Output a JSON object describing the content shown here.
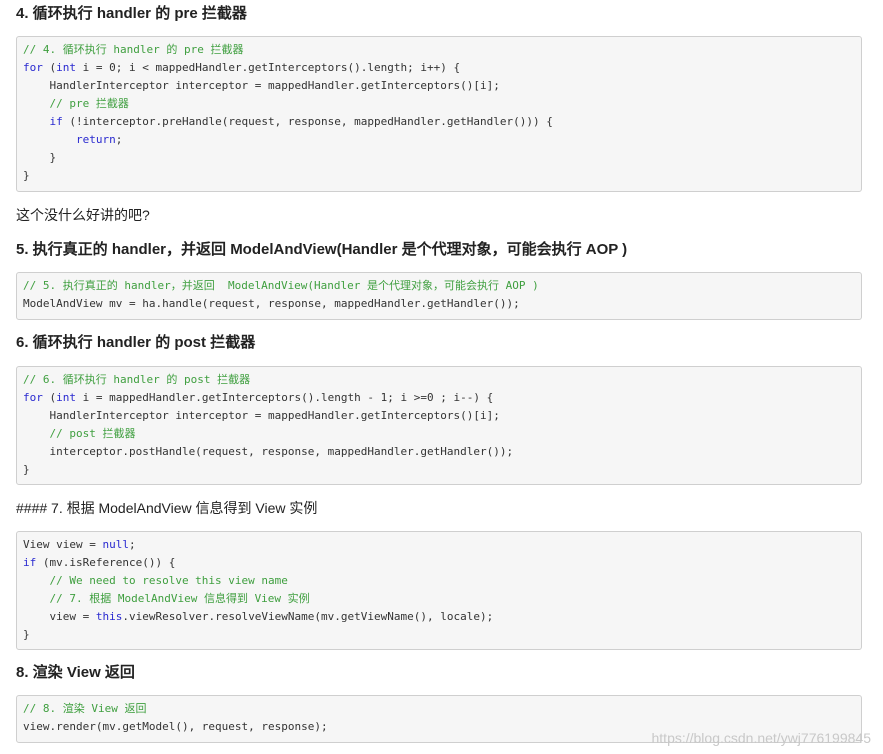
{
  "sections": {
    "s4": {
      "heading": "4. 循环执行 handler 的 pre 拦截器",
      "code": {
        "l1": "// 4. 循环执行 handler 的 pre 拦截器",
        "l2a": "for",
        "l2b": " (",
        "l2c": "int",
        "l2d": " i = 0; i < mappedHandler.getInterceptors().length; i++) {",
        "l3": "    HandlerInterceptor interceptor = mappedHandler.getInterceptors()[i];",
        "l4": "    // pre 拦截器",
        "l5a": "    ",
        "l5b": "if",
        "l5c": " (!interceptor.preHandle(request, response, mappedHandler.getHandler())) {",
        "l6a": "        ",
        "l6b": "return",
        "l6c": ";",
        "l7": "    }",
        "l8": "}"
      }
    },
    "p_between": "这个没什么好讲的吧?",
    "s5": {
      "heading": "5. 执行真正的 handler，并返回 ModelAndView(Handler 是个代理对象，可能会执行 AOP )",
      "code": {
        "l1": "// 5. 执行真正的 handler，并返回  ModelAndView(Handler 是个代理对象，可能会执行 AOP )",
        "l2": "ModelAndView mv = ha.handle(request, response, mappedHandler.getHandler());"
      }
    },
    "s6": {
      "heading": "6. 循环执行 handler 的 post 拦截器",
      "code": {
        "l1": "// 6. 循环执行 handler 的 post 拦截器",
        "l2a": "for",
        "l2b": " (",
        "l2c": "int",
        "l2d": " i = mappedHandler.getInterceptors().length - 1; i >=0 ; i--) {",
        "l3": "    HandlerInterceptor interceptor = mappedHandler.getInterceptors()[i];",
        "l4": "    // post 拦截器",
        "l5": "    interceptor.postHandle(request, response, mappedHandler.getHandler());",
        "l6": "}"
      }
    },
    "s7": {
      "heading": "#### 7. 根据 ModelAndView 信息得到 View 实例",
      "code": {
        "l1a": "View view = ",
        "l1b": "null",
        "l1c": ";",
        "l2a": "if",
        "l2b": " (mv.isReference()) {",
        "l3": "    // We need to resolve this view name",
        "l4": "    // 7. 根据 ModelAndView 信息得到 View 实例",
        "l5a": "    view = ",
        "l5b": "this",
        "l5c": ".viewResolver.resolveViewName(mv.getViewName(), locale);",
        "l6": "}"
      }
    },
    "s8": {
      "heading": "8. 渲染 View 返回",
      "code": {
        "l1": "// 8. 渲染 View 返回",
        "l2": "view.render(mv.getModel(), request, response);"
      }
    }
  },
  "watermark": "https://blog.csdn.net/ywj776199845",
  "colors": {
    "comment": "#3f9f3f",
    "keyword": "#2a2ad0",
    "code_bg": "#f6f6f6",
    "code_border": "#cfcfcf"
  }
}
